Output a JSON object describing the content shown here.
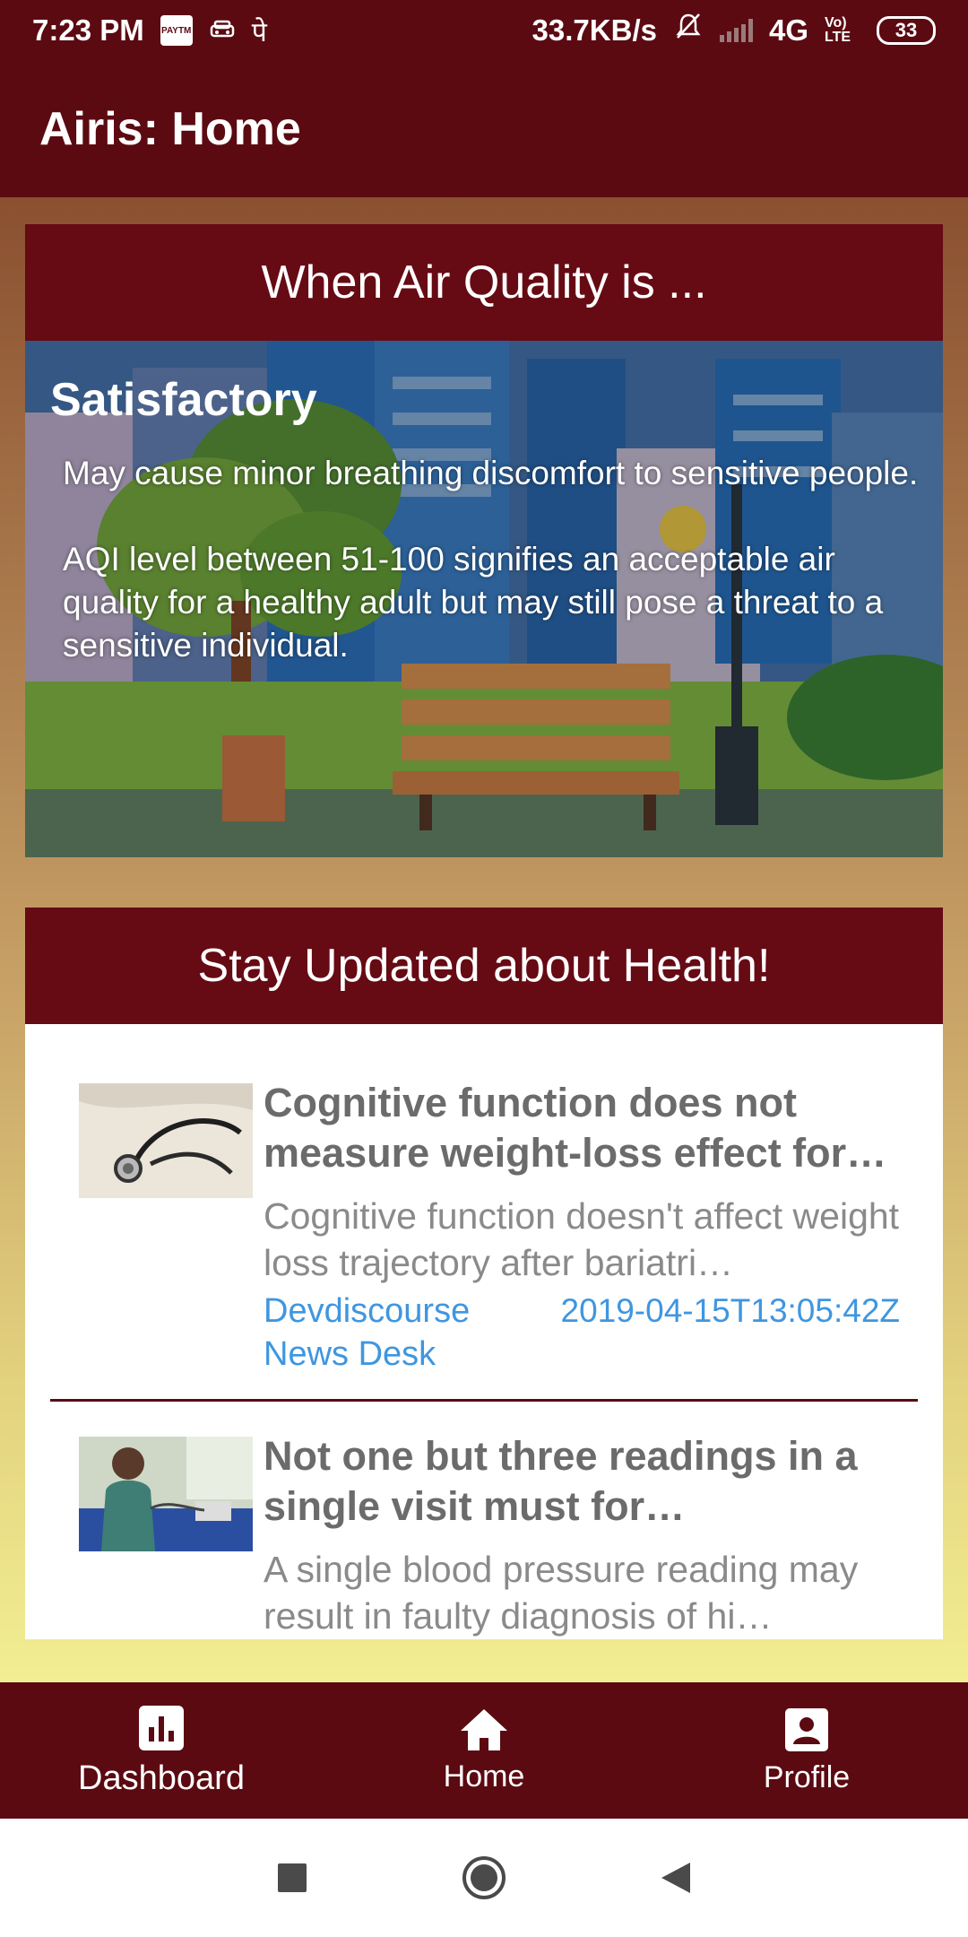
{
  "status_bar": {
    "time": "7:23 PM",
    "paytm_label": "PAYTM",
    "glyph": "पे",
    "net_speed": "33.7KB/s",
    "network": "4G",
    "volte": "Vo) LTE",
    "battery": "33",
    "icons": [
      "paytm-icon",
      "car-icon",
      "mute-bell-icon",
      "signal-icon",
      "battery-icon"
    ]
  },
  "app_bar": {
    "title": "Airis: Home"
  },
  "air_quality": {
    "header": "When Air Quality is ...",
    "level": "Satisfactory",
    "description": "May cause minor breathing discomfort to sensitive people.",
    "detail": "AQI level between 51-100 signifies an acceptable air quality for a healthy adult but may still pose a threat to a sensitive individual."
  },
  "news": {
    "header": "Stay Updated about Health!",
    "items": [
      {
        "title": "Cognitive function does not measure weight-loss effect for a…",
        "description": "Cognitive function doesn't affect weight loss trajectory after bariatri…",
        "source": "Devdiscourse News Desk",
        "date": "2019-04-15T13:05:42Z",
        "thumbnail": "stethoscope-image"
      },
      {
        "title": "Not one but three readings in a single visit must for hypertensio…",
        "description": "A single blood pressure reading may result in faulty diagnosis of hi…",
        "thumbnail": "blood-pressure-reading-image"
      }
    ]
  },
  "bottom_nav": {
    "items": [
      {
        "label": "Dashboard",
        "icon": "dashboard-icon"
      },
      {
        "label": "Home",
        "icon": "home-icon"
      },
      {
        "label": "Profile",
        "icon": "profile-icon"
      }
    ]
  },
  "colors": {
    "primary": "#5b0a12",
    "header": "#660a14",
    "link": "#3f96e0",
    "text_gray": "#6b6b6b"
  }
}
